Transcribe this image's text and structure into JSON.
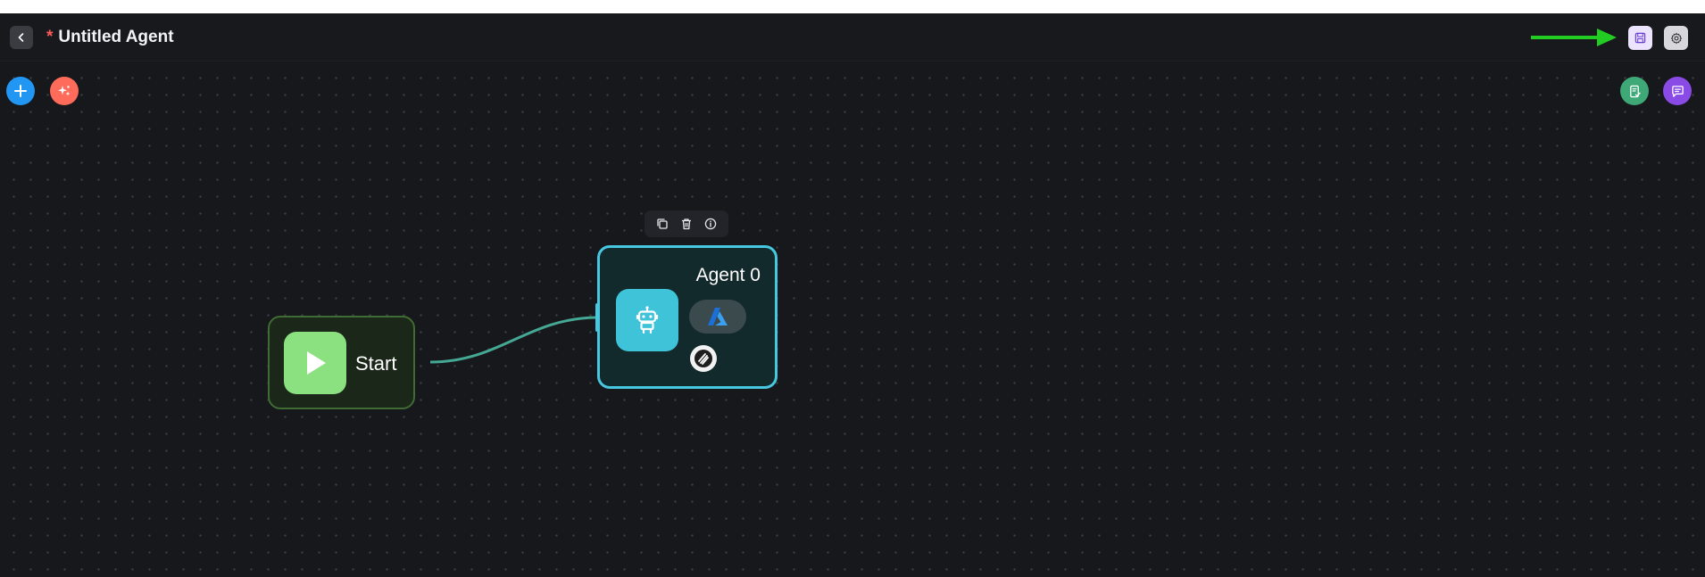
{
  "header": {
    "back_icon": "chevron-left-icon",
    "unsaved_marker": "*",
    "title": "Untitled Agent",
    "save_icon": "save-icon",
    "settings_icon": "gear-icon",
    "annotation_color": "#22cc22"
  },
  "canvas": {
    "add_icon": "plus-icon",
    "magic_icon": "sparkles-icon",
    "doc_icon": "document-check-icon",
    "chat_icon": "chat-icon",
    "add_color": "#2196f3",
    "magic_color": "#ff6b5b",
    "doc_color": "#3fa877",
    "chat_color": "#8a4ae6"
  },
  "start_node": {
    "label": "Start",
    "icon": "play-icon",
    "accent": "#8be07f"
  },
  "agent_node": {
    "title": "Agent 0",
    "icon": "robot-icon",
    "model_icon": "azure-icon",
    "tool_icon": "tool-logo-icon",
    "accent": "#48c7e0",
    "toolbar": [
      "copy-icon",
      "trash-icon",
      "info-icon"
    ]
  }
}
